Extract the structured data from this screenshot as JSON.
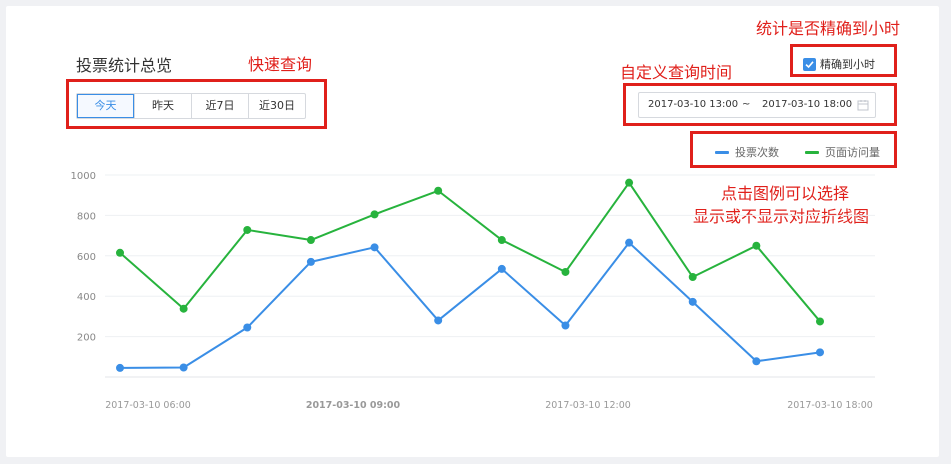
{
  "page": {
    "title": "投票统计总览"
  },
  "quick_query": {
    "buttons": [
      "今天",
      "昨天",
      "近7日",
      "近30日"
    ],
    "active_index": 0
  },
  "precise_hour": {
    "checked": true,
    "label": "精确到小时"
  },
  "date_range": {
    "start": "2017-03-10 13:00",
    "separator": "~",
    "end": "2017-03-10 18:00"
  },
  "annotations": {
    "quick_query": "快速查询",
    "precise_hour": "统计是否精确到小时",
    "custom_time": "自定义查询时间",
    "legend_line1": "点击图例可以选择",
    "legend_line2": "显示或不显示对应折线图"
  },
  "colors": {
    "accent": "#3a8ee6",
    "annotation": "#e0201b",
    "series_votes": "#3a8ee6",
    "series_views": "#27b33d"
  },
  "icons": {
    "checkbox": "checkmark-icon",
    "calendar": "calendar-icon"
  },
  "chart_data": {
    "type": "line",
    "ylim": [
      0,
      1000
    ],
    "yticks": [
      200,
      400,
      600,
      800,
      1000
    ],
    "xtick_labels": [
      "2017-03-10 06:00",
      "2017-03-10 09:00",
      "2017-03-10 12:00",
      "2017-03-10 18:00"
    ],
    "legend_position": "top-right",
    "grid": true,
    "series": [
      {
        "name": "投票次数",
        "values": [
          45,
          47,
          245,
          570,
          642,
          280,
          535,
          255,
          665,
          372,
          78,
          122
        ]
      },
      {
        "name": "页面访问量",
        "values": [
          615,
          338,
          728,
          678,
          805,
          922,
          678,
          520,
          962,
          495,
          650,
          275
        ]
      }
    ]
  }
}
